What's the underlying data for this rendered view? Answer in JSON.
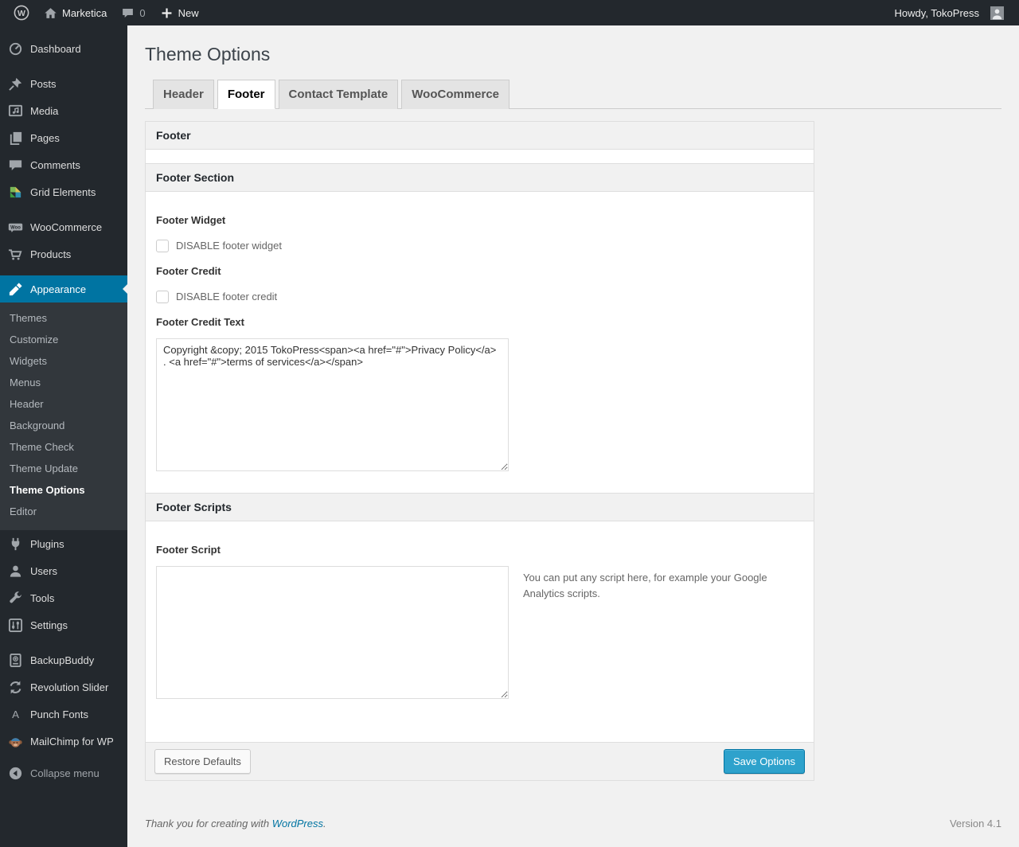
{
  "admin_bar": {
    "site_name": "Marketica",
    "comment_count": "0",
    "new_label": "New",
    "howdy": "Howdy, TokoPress"
  },
  "sidebar": {
    "items": [
      {
        "label": "Dashboard",
        "icon": "dashboard-icon"
      },
      {
        "label": "Posts",
        "icon": "pin-icon"
      },
      {
        "label": "Media",
        "icon": "media-icon"
      },
      {
        "label": "Pages",
        "icon": "pages-icon"
      },
      {
        "label": "Comments",
        "icon": "comments-icon"
      },
      {
        "label": "Grid Elements",
        "icon": "grid-elements-icon"
      },
      {
        "label": "WooCommerce",
        "icon": "woocommerce-icon"
      },
      {
        "label": "Products",
        "icon": "cart-icon"
      },
      {
        "label": "Appearance",
        "icon": "brush-icon",
        "active": true
      },
      {
        "label": "Plugins",
        "icon": "plugin-icon"
      },
      {
        "label": "Users",
        "icon": "user-icon"
      },
      {
        "label": "Tools",
        "icon": "wrench-icon"
      },
      {
        "label": "Settings",
        "icon": "settings-icon"
      },
      {
        "label": "BackupBuddy",
        "icon": "backup-icon"
      },
      {
        "label": "Revolution Slider",
        "icon": "refresh-icon"
      },
      {
        "label": "Punch Fonts",
        "icon": "letter-a-icon"
      },
      {
        "label": "MailChimp for WP",
        "icon": "monkey-icon"
      }
    ],
    "appearance_submenu": [
      {
        "label": "Themes"
      },
      {
        "label": "Customize"
      },
      {
        "label": "Widgets"
      },
      {
        "label": "Menus"
      },
      {
        "label": "Header"
      },
      {
        "label": "Background"
      },
      {
        "label": "Theme Check"
      },
      {
        "label": "Theme Update"
      },
      {
        "label": "Theme Options",
        "current": true
      },
      {
        "label": "Editor"
      }
    ],
    "collapse_label": "Collapse menu"
  },
  "page": {
    "title": "Theme Options",
    "tabs": [
      {
        "label": "Header",
        "active": false
      },
      {
        "label": "Footer",
        "active": true
      },
      {
        "label": "Contact Template",
        "active": false
      },
      {
        "label": "WooCommerce",
        "active": false
      }
    ],
    "panel": {
      "header": "Footer",
      "section1": {
        "title": "Footer Section",
        "footer_widget": {
          "label": "Footer Widget",
          "checkbox_label": "DISABLE footer widget",
          "checked": false
        },
        "footer_credit": {
          "label": "Footer Credit",
          "checkbox_label": "DISABLE footer credit",
          "checked": false
        },
        "footer_credit_text": {
          "label": "Footer Credit Text",
          "value": "Copyright &copy; 2015 TokoPress<span><a href=\"#\">Privacy Policy</a> . <a href=\"#\">terms of services</a></span>"
        }
      },
      "section2": {
        "title": "Footer Scripts",
        "footer_script": {
          "label": "Footer Script",
          "value": "",
          "help": "You can put any script here, for example your Google Analytics scripts."
        }
      },
      "buttons": {
        "restore": "Restore Defaults",
        "save": "Save Options"
      }
    }
  },
  "footer": {
    "thanks_prefix": "Thank you for creating with ",
    "wordpress_link": "WordPress",
    "thanks_suffix": ".",
    "version": "Version 4.1"
  },
  "colors": {
    "accent": "#0074a2",
    "primary_button": "#2ea2cc",
    "admin_dark": "#23282d"
  }
}
